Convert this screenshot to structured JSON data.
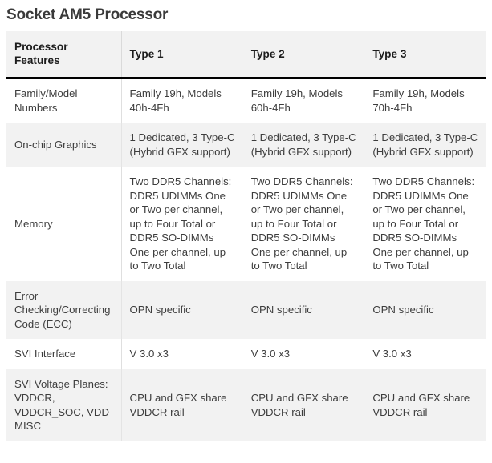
{
  "title": "Socket AM5 Processor",
  "table": {
    "columns": [
      {
        "key": "feature",
        "label": "Processor Features"
      },
      {
        "key": "type1",
        "label": "Type 1"
      },
      {
        "key": "type2",
        "label": "Type 2"
      },
      {
        "key": "type3",
        "label": "Type 3"
      }
    ],
    "rows": [
      {
        "feature": "Family/Model Numbers",
        "type1": "Family 19h, Models 40h-4Fh",
        "type2": "Family 19h, Models 60h-4Fh",
        "type3": "Family 19h, Models 70h-4Fh",
        "shaded": false
      },
      {
        "feature": "On-chip Graphics",
        "type1": "1 Dedicated, 3 Type-C (Hybrid GFX support)",
        "type2": "1 Dedicated, 3 Type-C (Hybrid GFX support)",
        "type3": "1 Dedicated, 3 Type-C (Hybrid GFX support)",
        "shaded": true
      },
      {
        "feature": "Memory",
        "type1": "Two DDR5 Channels: DDR5 UDIMMs One or Two per channel, up to Four Total or DDR5 SO-DIMMs One per channel, up to Two Total",
        "type2": "Two DDR5 Channels: DDR5 UDIMMs One or Two per channel, up to Four Total or DDR5 SO-DIMMs One per channel, up to Two Total",
        "type3": "Two DDR5 Channels: DDR5 UDIMMs One or Two per channel, up to Four Total or DDR5 SO-DIMMs One per channel, up to Two Total",
        "shaded": false
      },
      {
        "feature": "Error Checking/Correcting Code (ECC)",
        "type1": "OPN specific",
        "type2": "OPN specific",
        "type3": "OPN specific",
        "shaded": true
      },
      {
        "feature": "SVI Interface",
        "type1": "V 3.0 x3",
        "type2": "V 3.0 x3",
        "type3": "V 3.0 x3",
        "shaded": false
      },
      {
        "feature": "SVI Voltage Planes: VDDCR, VDDCR_SOC, VDD MISC",
        "type1": "CPU and GFX share VDDCR rail",
        "type2": "CPU and GFX share VDDCR rail",
        "type3": "CPU and GFX share VDDCR rail",
        "shaded": true
      }
    ]
  },
  "colors": {
    "header_background": "#f2f2f2",
    "header_rule": "#000000",
    "shaded_row": "#f2f2f2",
    "plain_row": "#ffffff",
    "column_divider": "#dfdfdf",
    "title_text": "#3a3a3a",
    "body_text": "#3d3d3d"
  }
}
